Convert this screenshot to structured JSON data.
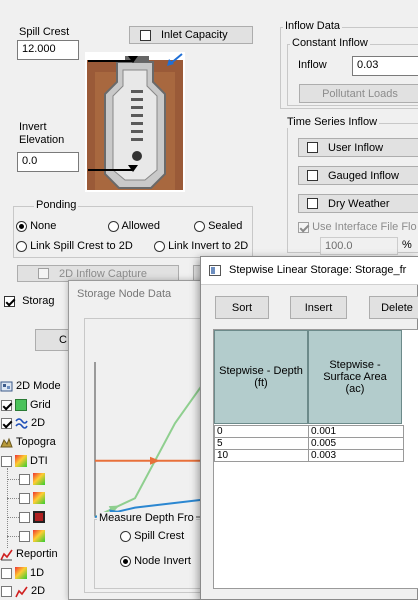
{
  "inlet_panel": {
    "spill_crest_label": "Spill Crest",
    "spill_crest_value": "12.000",
    "inlet_capacity_label": "Inlet Capacity",
    "invert_label_line1": "Invert",
    "invert_label_line2": "Elevation",
    "invert_value": "0.0"
  },
  "ponding": {
    "legend": "Ponding",
    "none_label": "None",
    "allowed_label": "Allowed",
    "sealed_label": "Sealed",
    "link_spill_label": "Link Spill Crest to 2D",
    "link_invert_label": "Link Invert to 2D",
    "selected": "None"
  },
  "inflow_capture_label": "2D Inflow Capture",
  "inflow_data": {
    "legend": "Inflow Data",
    "constant_legend": "Constant Inflow",
    "inflow_label": "Inflow",
    "inflow_value": "0.03",
    "pollutant_loads_label": "Pollutant Loads",
    "time_series_legend": "Time Series Inflow",
    "user_inflow_label": "User Inflow",
    "gauged_inflow_label": "Gauged Inflow",
    "dry_weather_label": "Dry Weather",
    "interface_file_label": "Use Interface File Flo",
    "interface_value": "100.0",
    "interface_unit": "%"
  },
  "storage_checkbox_label": "Storag",
  "storage_node_window": {
    "title": "Storage Node Data",
    "measure_legend": "Measure Depth Fro",
    "spill_crest_option": "Spill Crest",
    "node_invert_option": "Node Invert",
    "selected": "Node Invert",
    "partial_button": "C"
  },
  "tree": {
    "items": [
      {
        "label": "2D Mode"
      },
      {
        "label": "Grid"
      },
      {
        "label": "2D"
      },
      {
        "label": "Topogra"
      },
      {
        "label": "DTI"
      },
      {
        "label": ""
      },
      {
        "label": ""
      },
      {
        "label": ""
      },
      {
        "label": ""
      },
      {
        "label": "Reportin"
      },
      {
        "label": "1D"
      },
      {
        "label": "2D"
      }
    ]
  },
  "stepwise_window": {
    "title": "Stepwise Linear Storage: Storage_fr",
    "sort_label": "Sort",
    "insert_label": "Insert",
    "delete_label": "Delete",
    "col_depth_header": "Stepwise - Depth (ft)",
    "col_area_header": "Stepwise - Surface Area (ac)",
    "rows": [
      [
        "0",
        "0.001"
      ],
      [
        "5",
        "0.005"
      ],
      [
        "10",
        "0.003"
      ]
    ]
  },
  "chart_data": {
    "type": "line",
    "title": "",
    "xlabel": "",
    "ylabel": "",
    "series": [
      {
        "color": "#8fcf8f",
        "values": [
          [
            0,
            0
          ],
          [
            1,
            1
          ],
          [
            2,
            5
          ],
          [
            3,
            8
          ]
        ]
      },
      {
        "color": "#e8703a",
        "values": [
          [
            0,
            3
          ],
          [
            3,
            3
          ]
        ]
      },
      {
        "color": "#2b87d1",
        "values": [
          [
            0,
            0
          ],
          [
            1,
            0.5
          ],
          [
            3,
            1
          ]
        ]
      }
    ]
  },
  "colors": {
    "table_header_bg": "#b3cccc",
    "orange_series": "#e8703a",
    "green_series": "#8fcf8f",
    "blue_series": "#2b87d1"
  }
}
